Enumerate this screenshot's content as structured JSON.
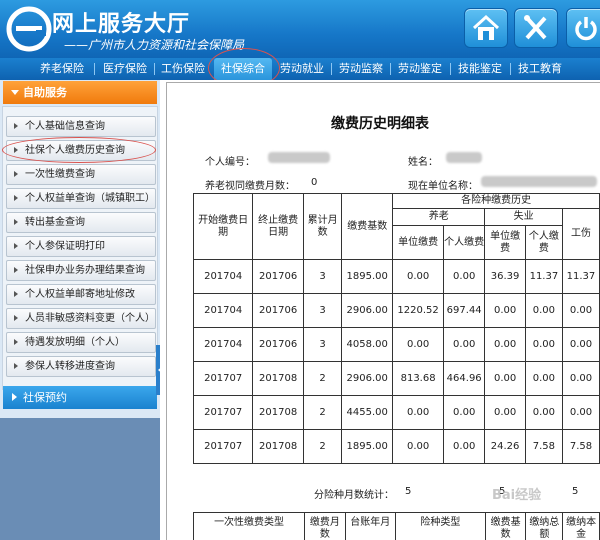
{
  "header": {
    "title": "网上服务大厅",
    "subtitle": "——广州市人力资源和社会保障局"
  },
  "nav": {
    "items": [
      {
        "label": "养老保险"
      },
      {
        "label": "医疗保险"
      },
      {
        "label": "工伤保险"
      },
      {
        "label": "社保综合"
      },
      {
        "label": "劳动就业"
      },
      {
        "label": "劳动监察"
      },
      {
        "label": "劳动鉴定"
      },
      {
        "label": "技能鉴定"
      },
      {
        "label": "技工教育"
      }
    ],
    "active": "社保综合"
  },
  "sidebar": {
    "header": "自助服务",
    "items": [
      {
        "label": "个人基础信息查询"
      },
      {
        "label": "社保个人缴费历史查询"
      },
      {
        "label": "一次性缴费查询"
      },
      {
        "label": "个人权益单查询（城镇职工）"
      },
      {
        "label": "转出基金查询"
      },
      {
        "label": "个人参保证明打印"
      },
      {
        "label": "社保申办业务办理结果查询"
      },
      {
        "label": "个人权益单邮寄地址修改"
      },
      {
        "label": "人员非敏感资料变更（个人）"
      },
      {
        "label": "待遇发放明细（个人）"
      },
      {
        "label": "参保人转移进度查询"
      }
    ],
    "footer": "社保预约"
  },
  "doc": {
    "title": "缴费历史明细表",
    "person_id_label": "个人编号：",
    "name_label": "姓名：",
    "pension_months_label": "养老视同缴费月数：",
    "pension_months_value": "0",
    "current_unit_label": "现在单位名称："
  },
  "table": {
    "headers": {
      "start": "开始缴费日期",
      "end": "终止缴费日期",
      "months": "累计月数",
      "base": "缴费基数",
      "group": "各险种缴费历史",
      "pension": "养老",
      "unemployment": "失业",
      "injury": "工伤",
      "unit_pay": "单位缴费",
      "personal_pay": "个人缴费"
    },
    "rows": [
      [
        "201704",
        "201706",
        "3",
        "1895.00",
        "0.00",
        "0.00",
        "36.39",
        "11.37",
        "11.37"
      ],
      [
        "201704",
        "201706",
        "3",
        "2906.00",
        "1220.52",
        "697.44",
        "0.00",
        "0.00",
        "0.00"
      ],
      [
        "201704",
        "201706",
        "3",
        "4058.00",
        "0.00",
        "0.00",
        "0.00",
        "0.00",
        "0.00"
      ],
      [
        "201707",
        "201708",
        "2",
        "2906.00",
        "813.68",
        "464.96",
        "0.00",
        "0.00",
        "0.00"
      ],
      [
        "201707",
        "201708",
        "2",
        "4455.00",
        "0.00",
        "0.00",
        "0.00",
        "0.00",
        "0.00"
      ],
      [
        "201707",
        "201708",
        "2",
        "1895.00",
        "0.00",
        "0.00",
        "24.26",
        "7.58",
        "7.58"
      ]
    ],
    "month_total_label": "分险种月数统计：",
    "month_totals": [
      "5",
      "5",
      "5"
    ]
  },
  "table2": {
    "headers": [
      "一次性缴费类型",
      "缴费月数",
      "台账年月",
      "险种类型",
      "缴费基数",
      "缴纳总额",
      "缴纳本金"
    ]
  },
  "watermark": "Bai经验"
}
